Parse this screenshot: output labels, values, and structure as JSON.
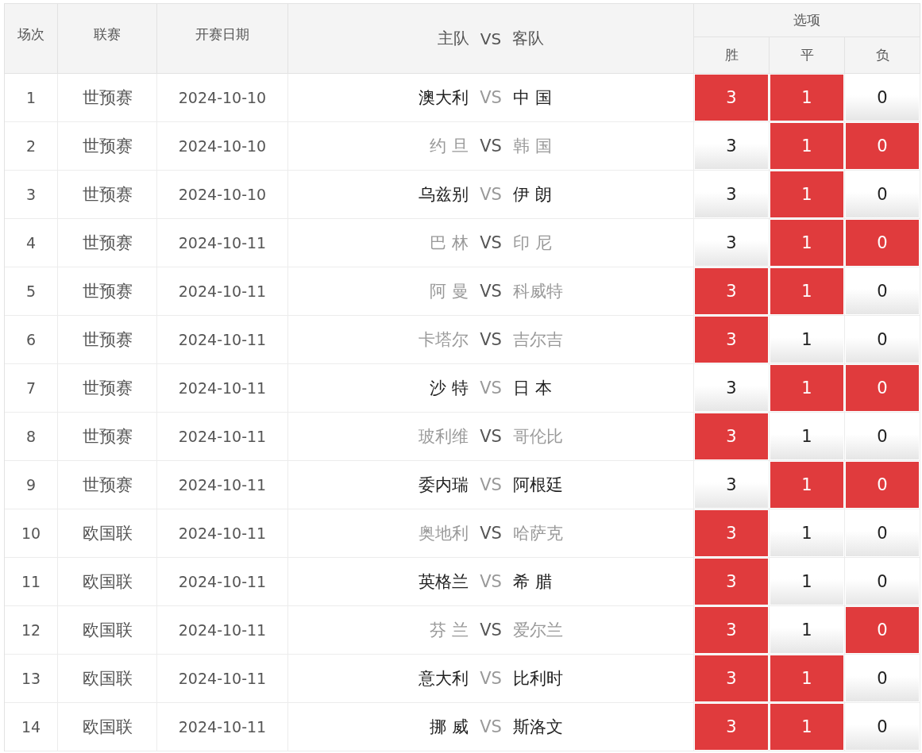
{
  "table": {
    "columns": [
      "场次",
      "联赛",
      "开赛日期"
    ],
    "match_header": {
      "home": "主队",
      "vs": "VS",
      "away": "客队"
    },
    "options_header": {
      "title": "选项",
      "labels": [
        "胜",
        "平",
        "负"
      ]
    },
    "rows": [
      {
        "no": "1",
        "league": "世预赛",
        "date": "2024-10-10",
        "home": "澳大利",
        "vs": "VS",
        "away": "中 国",
        "dimmed": false,
        "options": [
          {
            "label": "3",
            "selected": true
          },
          {
            "label": "1",
            "selected": true
          },
          {
            "label": "0",
            "selected": false
          }
        ]
      },
      {
        "no": "2",
        "league": "世预赛",
        "date": "2024-10-10",
        "home": "约 旦",
        "vs": "VS",
        "away": "韩 国",
        "dimmed": true,
        "options": [
          {
            "label": "3",
            "selected": false
          },
          {
            "label": "1",
            "selected": true
          },
          {
            "label": "0",
            "selected": true
          }
        ]
      },
      {
        "no": "3",
        "league": "世预赛",
        "date": "2024-10-10",
        "home": "乌兹别",
        "vs": "VS",
        "away": "伊 朗",
        "dimmed": false,
        "options": [
          {
            "label": "3",
            "selected": false
          },
          {
            "label": "1",
            "selected": true
          },
          {
            "label": "0",
            "selected": false
          }
        ]
      },
      {
        "no": "4",
        "league": "世预赛",
        "date": "2024-10-11",
        "home": "巴 林",
        "vs": "VS",
        "away": "印 尼",
        "dimmed": true,
        "options": [
          {
            "label": "3",
            "selected": false
          },
          {
            "label": "1",
            "selected": true
          },
          {
            "label": "0",
            "selected": true
          }
        ]
      },
      {
        "no": "5",
        "league": "世预赛",
        "date": "2024-10-11",
        "home": "阿 曼",
        "vs": "VS",
        "away": "科威特",
        "dimmed": true,
        "options": [
          {
            "label": "3",
            "selected": true
          },
          {
            "label": "1",
            "selected": true
          },
          {
            "label": "0",
            "selected": false
          }
        ]
      },
      {
        "no": "6",
        "league": "世预赛",
        "date": "2024-10-11",
        "home": "卡塔尔",
        "vs": "VS",
        "away": "吉尔吉",
        "dimmed": true,
        "options": [
          {
            "label": "3",
            "selected": true
          },
          {
            "label": "1",
            "selected": false
          },
          {
            "label": "0",
            "selected": false
          }
        ]
      },
      {
        "no": "7",
        "league": "世预赛",
        "date": "2024-10-11",
        "home": "沙 特",
        "vs": "VS",
        "away": "日 本",
        "dimmed": false,
        "options": [
          {
            "label": "3",
            "selected": false
          },
          {
            "label": "1",
            "selected": true
          },
          {
            "label": "0",
            "selected": true
          }
        ]
      },
      {
        "no": "8",
        "league": "世预赛",
        "date": "2024-10-11",
        "home": "玻利维",
        "vs": "VS",
        "away": "哥伦比",
        "dimmed": true,
        "options": [
          {
            "label": "3",
            "selected": true
          },
          {
            "label": "1",
            "selected": false
          },
          {
            "label": "0",
            "selected": false
          }
        ]
      },
      {
        "no": "9",
        "league": "世预赛",
        "date": "2024-10-11",
        "home": "委内瑞",
        "vs": "VS",
        "away": "阿根廷",
        "dimmed": false,
        "options": [
          {
            "label": "3",
            "selected": false
          },
          {
            "label": "1",
            "selected": true
          },
          {
            "label": "0",
            "selected": true
          }
        ]
      },
      {
        "no": "10",
        "league": "欧国联",
        "date": "2024-10-11",
        "home": "奥地利",
        "vs": "VS",
        "away": "哈萨克",
        "dimmed": true,
        "options": [
          {
            "label": "3",
            "selected": true
          },
          {
            "label": "1",
            "selected": false
          },
          {
            "label": "0",
            "selected": false
          }
        ]
      },
      {
        "no": "11",
        "league": "欧国联",
        "date": "2024-10-11",
        "home": "英格兰",
        "vs": "VS",
        "away": "希 腊",
        "dimmed": false,
        "options": [
          {
            "label": "3",
            "selected": true
          },
          {
            "label": "1",
            "selected": false
          },
          {
            "label": "0",
            "selected": false
          }
        ]
      },
      {
        "no": "12",
        "league": "欧国联",
        "date": "2024-10-11",
        "home": "芬 兰",
        "vs": "VS",
        "away": "爱尔兰",
        "dimmed": true,
        "options": [
          {
            "label": "3",
            "selected": true
          },
          {
            "label": "1",
            "selected": false
          },
          {
            "label": "0",
            "selected": true
          }
        ]
      },
      {
        "no": "13",
        "league": "欧国联",
        "date": "2024-10-11",
        "home": "意大利",
        "vs": "VS",
        "away": "比利时",
        "dimmed": false,
        "options": [
          {
            "label": "3",
            "selected": true
          },
          {
            "label": "1",
            "selected": true
          },
          {
            "label": "0",
            "selected": false
          }
        ]
      },
      {
        "no": "14",
        "league": "欧国联",
        "date": "2024-10-11",
        "home": "挪 威",
        "vs": "VS",
        "away": "斯洛文",
        "dimmed": false,
        "options": [
          {
            "label": "3",
            "selected": true
          },
          {
            "label": "1",
            "selected": true
          },
          {
            "label": "0",
            "selected": false
          }
        ]
      }
    ]
  }
}
